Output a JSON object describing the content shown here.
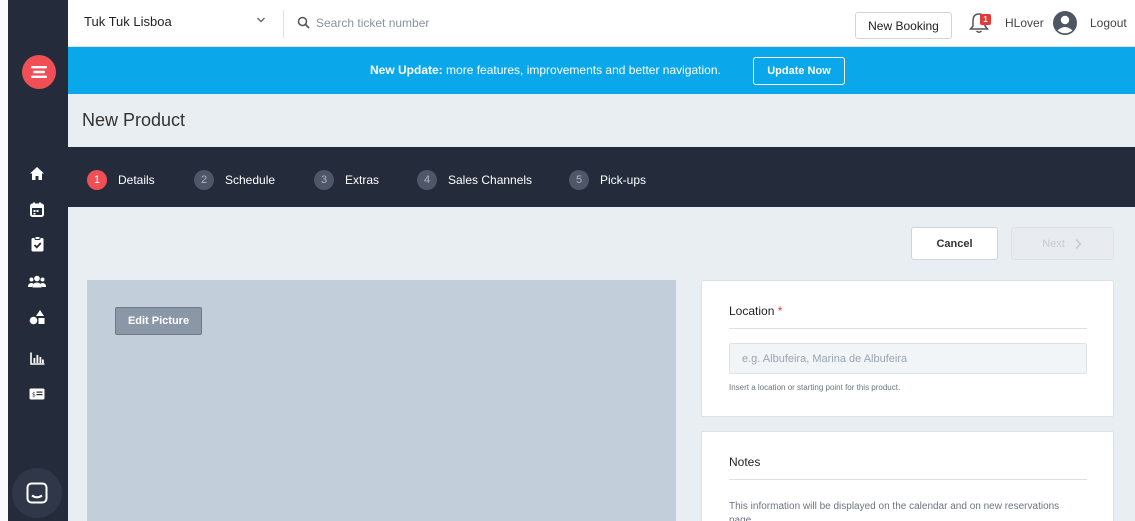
{
  "topbar": {
    "account_name": "Tuk Tuk Lisboa",
    "search_placeholder": "Search ticket number",
    "new_booking_label": "New Booking",
    "notification_count": "1",
    "username": "HLover",
    "logout_label": "Logout"
  },
  "banner": {
    "bold_text": "New Update:",
    "text": " more features, improvements and better navigation.",
    "button_label": "Update Now"
  },
  "page": {
    "title": "New Product"
  },
  "steps": [
    {
      "num": "1",
      "label": "Details"
    },
    {
      "num": "2",
      "label": "Schedule"
    },
    {
      "num": "3",
      "label": "Extras"
    },
    {
      "num": "4",
      "label": "Sales Channels"
    },
    {
      "num": "5",
      "label": "Pick-ups"
    }
  ],
  "actions": {
    "cancel_label": "Cancel",
    "next_label": "Next"
  },
  "picture": {
    "edit_label": "Edit Picture"
  },
  "location": {
    "title": "Location",
    "required_mark": "*",
    "placeholder": "e.g. Albufeira, Marina de Albufeira",
    "help": "Insert a location or starting point for this product."
  },
  "notes": {
    "title": "Notes",
    "text": "This information will be displayed on the calendar and on new reservations page."
  },
  "sidebar_icons": [
    "home-icon",
    "calendar-icon",
    "clipboard-check-icon",
    "users-icon",
    "shapes-icon",
    "bar-chart-icon",
    "ticket-icon"
  ],
  "colors": {
    "brand_red": "#ef4f55",
    "banner_blue": "#0aa7ea",
    "dark_nav": "#242b3a"
  }
}
